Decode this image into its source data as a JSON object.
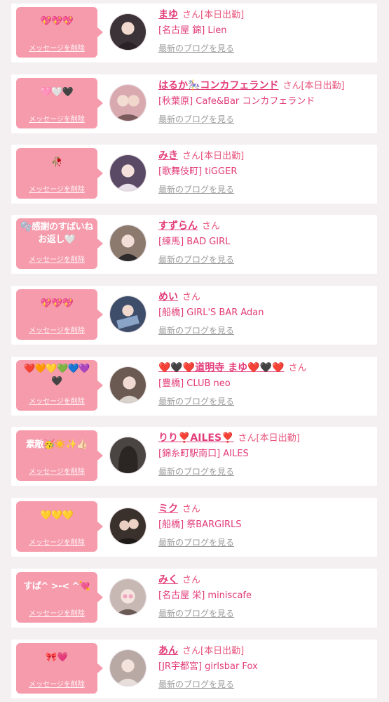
{
  "delete_label": "メッセージを削除",
  "blog_label": "最新のブログを見る",
  "honorific": "さん",
  "cards": [
    {
      "message": "💖💖💖",
      "name": "まゆ",
      "working": "[本日出勤]",
      "shop": "[名古屋 錦] Lien",
      "avatar_color": "#3b3338"
    },
    {
      "message": "🩷🤍🖤",
      "name": "はるか🎠コンカフェランド",
      "working": "[本日出勤]",
      "shop": "[秋葉原] Cafe&Bar コンカフェランド",
      "avatar_color": "#d9a9b0"
    },
    {
      "message": "🥀",
      "name": "みき",
      "working": "[本日出勤]",
      "shop": "[歌舞伎町] tiGGER",
      "avatar_color": "#5a4a66"
    },
    {
      "message": "🫧感謝のすばいね\nお返し🤍",
      "name": "すずらん",
      "working": "",
      "shop": "[練馬] BAD GIRL",
      "avatar_color": "#8c7a6e"
    },
    {
      "message": "💖💖💖",
      "name": "めい",
      "working": "",
      "shop": "[船橋] GIRL'S BAR Adan",
      "avatar_color": "#3d4d6a"
    },
    {
      "message": "❤️🧡💛💚💙💜\n🖤",
      "name": "❤️🖤❤️道明寺 まゆ❤️🖤❤️",
      "working": "",
      "shop": "[豊橋] CLUB neo",
      "avatar_color": "#6b5a52"
    },
    {
      "message": "素敵🥳☀️✨👍🏻",
      "name": "りり❣️AILES❣️",
      "working": "[本日出勤]",
      "shop": "[錦糸町駅南口] AILES",
      "avatar_color": "#4a4442"
    },
    {
      "message": "💛💛💛",
      "name": "ミク",
      "working": "",
      "shop": "[船橋] 祭BARGIRLS",
      "avatar_color": "#3a302c"
    },
    {
      "message": "すば^ >-< ^💘",
      "name": "みく",
      "working": "",
      "shop": "[名古屋 栄] miniscafe",
      "avatar_color": "#c7b8b4"
    },
    {
      "message": "🎀💗",
      "name": "あん",
      "working": "[本日出勤]",
      "shop": "[JR宇都宮] girlsbar Fox",
      "avatar_color": "#b9a9a4"
    }
  ]
}
